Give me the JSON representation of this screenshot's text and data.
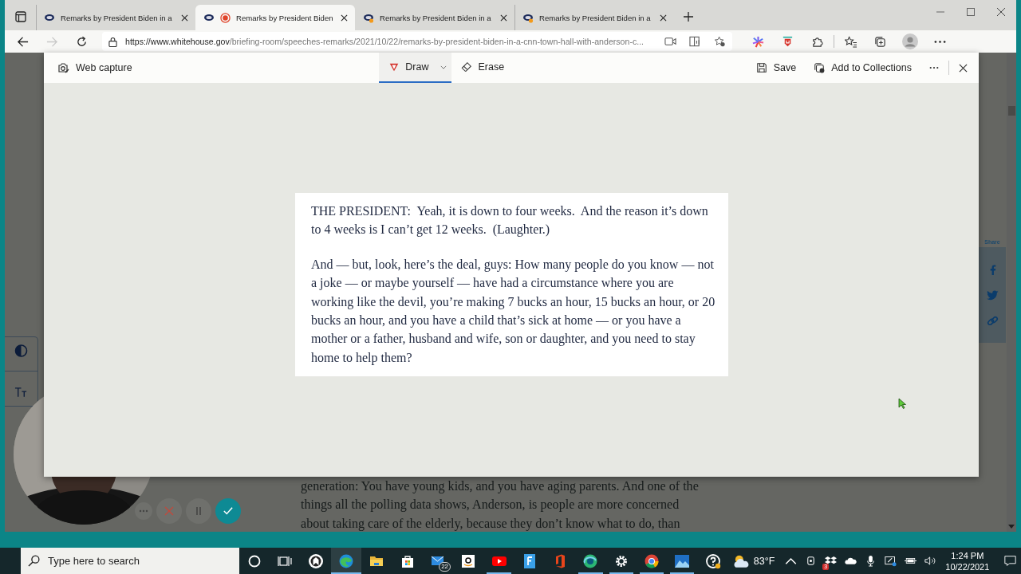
{
  "tabs": [
    {
      "title": "Remarks by President Biden in a",
      "selected": false,
      "recording": false,
      "alert": false
    },
    {
      "title": "Remarks by President Biden",
      "selected": true,
      "recording": true,
      "alert": false
    },
    {
      "title": "Remarks by President Biden in a",
      "selected": false,
      "recording": false,
      "alert": true
    },
    {
      "title": "Remarks by President Biden in a",
      "selected": false,
      "recording": false,
      "alert": true
    }
  ],
  "address": {
    "url_host": "https://www.whitehouse.gov",
    "url_path": "/briefing-room/speeches-remarks/2021/10/22/remarks-by-president-biden-in-a-cnn-town-hall-with-anderson-c...",
    "forward_disabled": true
  },
  "capture_toolbar": {
    "title": "Web capture",
    "tools": [
      {
        "kind": "draw",
        "label": "Draw",
        "selected": true
      },
      {
        "kind": "erase",
        "label": "Erase",
        "selected": false
      }
    ],
    "actions": [
      {
        "kind": "save",
        "label": "Save"
      },
      {
        "kind": "collections",
        "label": "Add to Collections"
      }
    ]
  },
  "excerpt": {
    "paragraphs": [
      "THE PRESIDENT:  Yeah, it is down to four weeks.  And the reason it’s down to 4 weeks is I can’t get 12 weeks.  (Laughter.)",
      "And — but, look, here’s the deal, guys: How many people do you know — not a joke — or maybe yourself — have had a circumstance where you are working like the devil, you’re making 7 bucks an hour, 15 bucks an hour, or 20 bucks an hour, and you have a child that’s sick at home — or you have a mother or a father, husband and wife, son or daughter, and you need to stay home to help them?"
    ]
  },
  "page": {
    "share_label": "Share",
    "text_lines": [
      "generation: You have young kids, and you have aging parents.  And one of the",
      "things all the polling data shows, Anderson, is people are more concerned",
      "about taking care of the elderly, because they don’t know what to do, than"
    ]
  },
  "taskbar": {
    "search_placeholder": "Type here to search",
    "apps": [
      {
        "kind": "cortana",
        "running": false,
        "active": false
      },
      {
        "kind": "taskview",
        "running": false,
        "active": false
      },
      {
        "kind": "ring",
        "running": false,
        "active": false
      },
      {
        "kind": "edge",
        "running": true,
        "active": true
      },
      {
        "kind": "folder",
        "running": false,
        "active": false
      },
      {
        "kind": "store",
        "running": false,
        "active": false
      },
      {
        "kind": "mail",
        "running": false,
        "active": false,
        "badge": "22"
      },
      {
        "kind": "amazon",
        "running": false,
        "active": false
      },
      {
        "kind": "youtube",
        "running": true,
        "active": false
      },
      {
        "kind": "letter",
        "running": false,
        "active": false
      },
      {
        "kind": "office",
        "running": false,
        "active": false
      },
      {
        "kind": "edgedev",
        "running": true,
        "active": false
      },
      {
        "kind": "settings",
        "running": true,
        "active": false
      },
      {
        "kind": "chrome",
        "running": true,
        "active": false
      },
      {
        "kind": "photos",
        "running": true,
        "active": false
      },
      {
        "kind": "help",
        "running": false,
        "active": false
      }
    ],
    "weather": "83°F",
    "dropbox_badge": "3",
    "time": "1:24 PM",
    "date": "10/22/2021"
  }
}
